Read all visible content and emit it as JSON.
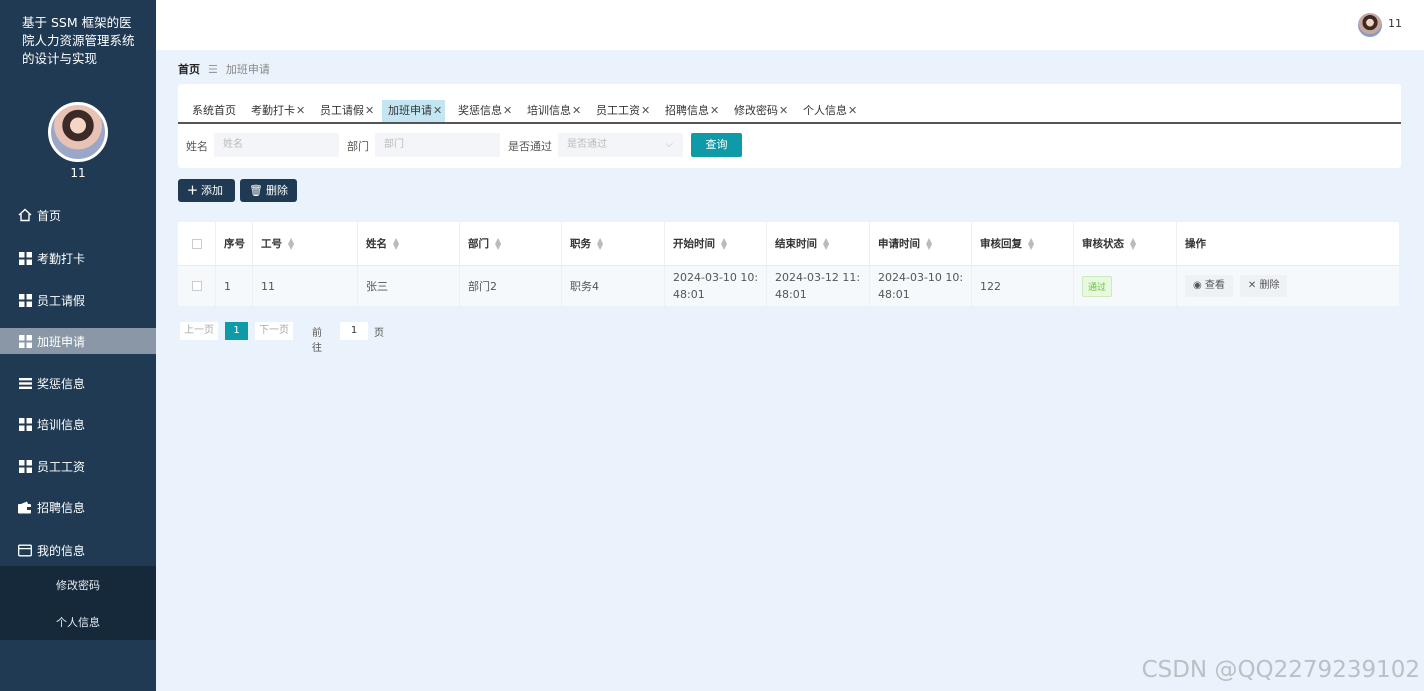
{
  "app": {
    "title": "基于 SSM 框架的医院人力资源管理系统的设计与实现",
    "user": "11"
  },
  "sidebar": {
    "items": [
      {
        "label": "首页",
        "icon": "home-icon"
      },
      {
        "label": "考勤打卡",
        "icon": "grid-icon"
      },
      {
        "label": "员工请假",
        "icon": "grid-icon"
      },
      {
        "label": "加班申请",
        "icon": "grid-icon",
        "active": true
      },
      {
        "label": "奖惩信息",
        "icon": "list-icon"
      },
      {
        "label": "培训信息",
        "icon": "grid-icon"
      },
      {
        "label": "员工工资",
        "icon": "grid-icon"
      },
      {
        "label": "招聘信息",
        "icon": "wallet-icon"
      },
      {
        "label": "我的信息",
        "icon": "card-icon"
      }
    ],
    "sub_items": [
      {
        "label": "修改密码"
      },
      {
        "label": "个人信息"
      }
    ]
  },
  "breadcrumb": {
    "home": "首页",
    "sep": "☰",
    "current": "加班申请"
  },
  "tabs": [
    {
      "label": "系统首页",
      "closable": false
    },
    {
      "label": "考勤打卡",
      "closable": true
    },
    {
      "label": "员工请假",
      "closable": true
    },
    {
      "label": "加班申请",
      "closable": true,
      "active": true
    },
    {
      "label": "奖惩信息",
      "closable": true
    },
    {
      "label": "培训信息",
      "closable": true
    },
    {
      "label": "员工工资",
      "closable": true
    },
    {
      "label": "招聘信息",
      "closable": true
    },
    {
      "label": "修改密码",
      "closable": true
    },
    {
      "label": "个人信息",
      "closable": true
    }
  ],
  "filters": {
    "name_label": "姓名",
    "name_placeholder": "姓名",
    "dept_label": "部门",
    "dept_placeholder": "部门",
    "pass_label": "是否通过",
    "pass_placeholder": "是否通过",
    "search_label": "查询"
  },
  "actions": {
    "add_label": "添加",
    "delete_label": "删除"
  },
  "table": {
    "columns": [
      "序号",
      "工号",
      "姓名",
      "部门",
      "职务",
      "开始时间",
      "结束时间",
      "申请时间",
      "审核回复",
      "审核状态",
      "操作"
    ],
    "rows": [
      {
        "index": "1",
        "emp_no": "11",
        "name": "张三",
        "dept": "部门2",
        "position": "职务4",
        "start": "2024-03-10 10:48:01",
        "end": "2024-03-12 11:48:01",
        "applied": "2024-03-10 10:48:01",
        "reply": "122",
        "status": "通过",
        "view_label": "查看",
        "delete_label": "删除"
      }
    ]
  },
  "pagination": {
    "prev": "上一页",
    "current": "1",
    "next": "下一页",
    "goto_label": "前往",
    "goto_value": "1",
    "page_suffix": "页"
  },
  "watermark": "CSDN @QQ2279239102"
}
